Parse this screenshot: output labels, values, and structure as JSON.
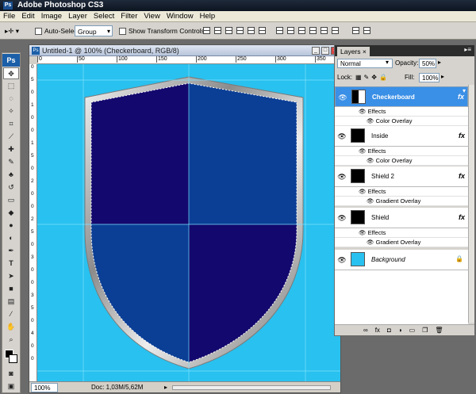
{
  "app": {
    "title": "Adobe Photoshop CS3",
    "badge": "Ps"
  },
  "menu": [
    "File",
    "Edit",
    "Image",
    "Layer",
    "Select",
    "Filter",
    "View",
    "Window",
    "Help"
  ],
  "options": {
    "auto_select_label": "Auto-Select:",
    "auto_select_value": "Group",
    "transform_label": "Show Transform Controls"
  },
  "document": {
    "title": "Untitled-1 @ 100% (Checkerboard, RGB/8)",
    "ruler_top": [
      "0",
      "50",
      "100",
      "150",
      "200",
      "250",
      "300",
      "350",
      "400"
    ],
    "ruler_left": [
      "0",
      "5",
      "0",
      "1",
      "0",
      "0",
      "1",
      "5",
      "0",
      "2",
      "0",
      "0",
      "2",
      "5",
      "0",
      "3",
      "0",
      "0",
      "3",
      "5",
      "0",
      "4",
      "0",
      "0"
    ],
    "zoom": "100%",
    "doc_info": "Doc: 1,03M/5,62M"
  },
  "canvas": {
    "background": "#29c1ef",
    "quad_dark": "#13086e",
    "quad_light": "#0b3f96",
    "guide_color": "#7de0ff"
  },
  "layers_panel": {
    "tab": "Layers",
    "blend_mode": "Normal",
    "opacity_label": "Opacity:",
    "opacity_value": "50%",
    "lock_label": "Lock:",
    "fill_label": "Fill:",
    "fill_value": "100%",
    "layers": [
      {
        "name": "Checkerboard",
        "selected": true,
        "effects_label": "Effects",
        "effect": "Color Overlay"
      },
      {
        "name": "Inside",
        "selected": false,
        "effects_label": "Effects",
        "effect": "Color Overlay"
      },
      {
        "name": "Shield 2",
        "selected": false,
        "effects_label": "Effects",
        "effect": "Gradient Overlay"
      },
      {
        "name": "Shield",
        "selected": false,
        "effects_label": "Effects",
        "effect": "Gradient Overlay"
      }
    ],
    "background_layer": "Background",
    "fx_symbol": "fx"
  }
}
